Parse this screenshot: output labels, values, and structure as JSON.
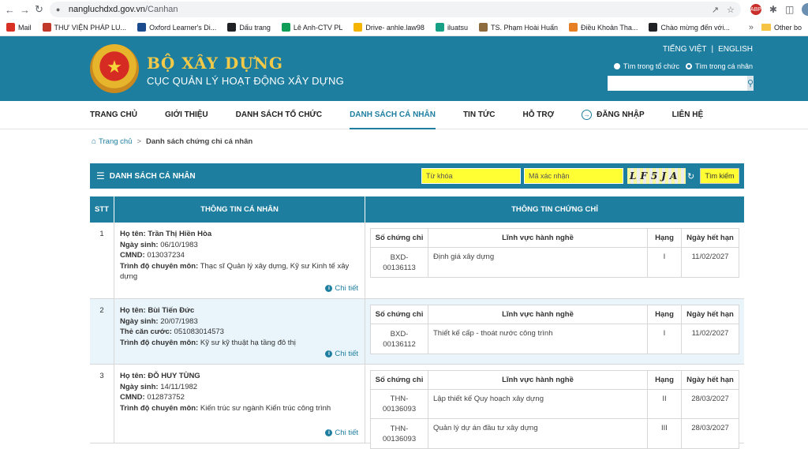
{
  "browser": {
    "url_host": "nangluchdxd.gov.vn",
    "url_path": "/Canhan",
    "bookmarks": [
      {
        "label": "Mail",
        "color": "#d93025"
      },
      {
        "label": "THƯ VIỆN PHÁP LU...",
        "color": "#c0392b"
      },
      {
        "label": "Oxford Learner's Di...",
        "color": "#1a4b8c"
      },
      {
        "label": "Dấu trang",
        "color": "#202124"
      },
      {
        "label": "Lê Anh-CTV PL",
        "color": "#0f9d58"
      },
      {
        "label": "Drive- anhle.law98",
        "color": "#f4b400"
      },
      {
        "label": "iluatsu",
        "color": "#16a085"
      },
      {
        "label": "TS. Phạm Hoài Huấn",
        "color": "#8e6b3e"
      },
      {
        "label": "Điều Khoản Tha...",
        "color": "#e67e22"
      },
      {
        "label": "Chào mừng đến với...",
        "color": "#202124"
      }
    ],
    "bookmarks_other": "Other bo"
  },
  "header": {
    "title": "BỘ XÂY DỰNG",
    "subtitle": "CỤC QUẢN LÝ HOẠT ĐỘNG XÂY DỰNG",
    "lang_vi": "TIẾNG VIỆT",
    "lang_sep": "|",
    "lang_en": "ENGLISH",
    "radio_org": "Tìm trong tổ chức",
    "radio_person": "Tìm trong cá nhân",
    "accent": "#1d7ea0",
    "brand_gold": "#f3c948"
  },
  "nav": {
    "items": [
      "TRANG CHỦ",
      "GIỚI THIỆU",
      "DANH SÁCH TỔ CHỨC",
      "DANH SÁCH CÁ NHÂN",
      "TIN TỨC",
      "HỖ TRỢ",
      "ĐĂNG NHẬP",
      "LIÊN HỆ"
    ],
    "active": "DANH SÁCH CÁ NHÂN"
  },
  "breadcrumb": {
    "home": "Trang chủ",
    "sep": ">",
    "current": "Danh sách chứng chỉ cá nhân"
  },
  "list_bar": {
    "title": "DANH SÁCH CÁ NHÂN",
    "keyword_placeholder": "Từ khóa",
    "captcha_placeholder": "Mã xác nhận",
    "captcha_text": "LF5JA",
    "search_label": "Tìm kiếm",
    "highlight": "#ffff33"
  },
  "table": {
    "col_stt": "STT",
    "col_info": "THÔNG TIN CÁ NHÂN",
    "col_cert": "THÔNG TIN CHỨNG CHỈ",
    "sub_cols": [
      "Số chứng chỉ",
      "Lĩnh vực hành nghề",
      "Hạng",
      "Ngày hết hạn"
    ],
    "detail_label": "Chi tiết",
    "rows": [
      {
        "stt": "1",
        "fields": [
          {
            "label": "Họ tên:",
            "value": "Trần Thị Hiền Hòa",
            "bold": true
          },
          {
            "label": "Ngày sinh:",
            "value": "06/10/1983"
          },
          {
            "label": "CMND:",
            "value": "013037234"
          },
          {
            "label": "Trình độ chuyên môn:",
            "value": "Thạc sĩ Quản lý xây dựng, Kỹ sư Kinh tế xây dựng"
          }
        ],
        "certs": [
          {
            "no": "BXD-00136113",
            "field": "Định giá xây dựng",
            "rank": "I",
            "expiry": "11/02/2027"
          }
        ]
      },
      {
        "stt": "2",
        "fields": [
          {
            "label": "Họ tên:",
            "value": "Bùi Tiến Đức",
            "bold": true
          },
          {
            "label": "Ngày sinh:",
            "value": "20/07/1983"
          },
          {
            "label": "Thẻ căn cước:",
            "value": "051083014573"
          },
          {
            "label": "Trình độ chuyên môn:",
            "value": "Kỹ sư kỹ thuật hạ tầng đô thị"
          }
        ],
        "certs": [
          {
            "no": "BXD-00136112",
            "field": "Thiết kế cấp - thoát nước công trình",
            "rank": "I",
            "expiry": "11/02/2027"
          }
        ]
      },
      {
        "stt": "3",
        "fields": [
          {
            "label": "Họ tên:",
            "value": "ĐỖ HUY TÙNG",
            "bold": true
          },
          {
            "label": "Ngày sinh:",
            "value": "14/11/1982"
          },
          {
            "label": "CMND:",
            "value": "012873752"
          },
          {
            "label": "Trình độ chuyên môn:",
            "value": "Kiến trúc sư ngành Kiến trúc công trình"
          }
        ],
        "certs": [
          {
            "no": "THN-00136093",
            "field": "Lập thiết kế Quy hoạch xây dựng",
            "rank": "II",
            "expiry": "28/03/2027"
          },
          {
            "no": "THN-00136093",
            "field": "Quản lý dự án đầu tư xây dựng",
            "rank": "III",
            "expiry": "28/03/2027"
          }
        ]
      }
    ]
  }
}
